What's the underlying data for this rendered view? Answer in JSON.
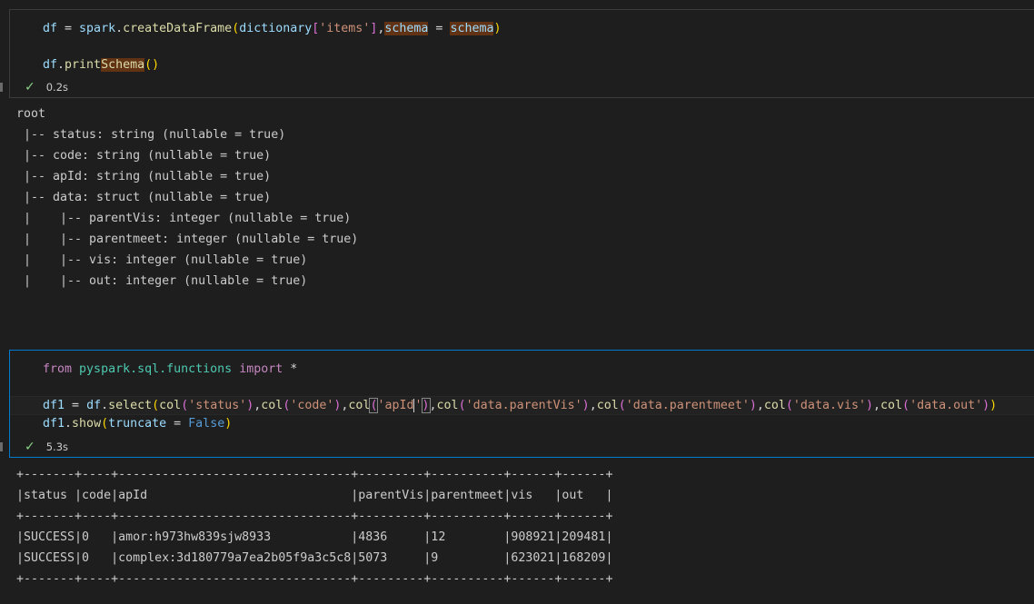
{
  "colors": {
    "background": "#1e1e1e",
    "focus_border": "#007acc",
    "success": "#89d185"
  },
  "cells": [
    {
      "code_lines": [
        [
          {
            "t": "df",
            "c": "#9cdcfe"
          },
          {
            "t": " = ",
            "c": "#d4d4d4"
          },
          {
            "t": "spark",
            "c": "#9cdcfe"
          },
          {
            "t": ".",
            "c": "#d4d4d4"
          },
          {
            "t": "createDataFrame",
            "c": "#dcdcaa"
          },
          {
            "t": "(",
            "c": "#ffd700"
          },
          {
            "t": "dictionary",
            "c": "#9cdcfe"
          },
          {
            "t": "[",
            "c": "#da70d6"
          },
          {
            "t": "'items'",
            "c": "#ce9178"
          },
          {
            "t": "]",
            "c": "#da70d6"
          },
          {
            "t": ",",
            "c": "#d4d4d4"
          },
          {
            "t": "schema",
            "c": "#9cdcfe",
            "hl": true
          },
          {
            "t": " = ",
            "c": "#d4d4d4"
          },
          {
            "t": "schema",
            "c": "#9cdcfe",
            "hl": true
          },
          {
            "t": ")",
            "c": "#ffd700"
          }
        ],
        [],
        [
          {
            "t": "df",
            "c": "#9cdcfe"
          },
          {
            "t": ".",
            "c": "#d4d4d4"
          },
          {
            "t": "print",
            "c": "#dcdcaa"
          },
          {
            "t": "Schema",
            "c": "#dcdcaa",
            "hl": true
          },
          {
            "t": "()",
            "c": "#ffd700"
          }
        ]
      ],
      "status_icon": "check-icon",
      "duration": "0.2s",
      "output": [
        "root",
        " |-- status: string (nullable = true)",
        " |-- code: string (nullable = true)",
        " |-- apId: string (nullable = true)",
        " |-- data: struct (nullable = true)",
        " |    |-- parentVis: integer (nullable = true)",
        " |    |-- parentmeet: integer (nullable = true)",
        " |    |-- vis: integer (nullable = true)",
        " |    |-- out: integer (nullable = true)"
      ]
    },
    {
      "code_lines": [
        [
          {
            "t": "from",
            "c": "#c586c0"
          },
          {
            "t": " ",
            "c": "#d4d4d4"
          },
          {
            "t": "pyspark.sql.functions",
            "c": "#4ec9b0"
          },
          {
            "t": " ",
            "c": "#d4d4d4"
          },
          {
            "t": "import",
            "c": "#c586c0"
          },
          {
            "t": " *",
            "c": "#d4d4d4"
          }
        ],
        [],
        [
          {
            "t": "df1",
            "c": "#9cdcfe"
          },
          {
            "t": " = ",
            "c": "#d4d4d4"
          },
          {
            "t": "df",
            "c": "#9cdcfe"
          },
          {
            "t": ".",
            "c": "#d4d4d4"
          },
          {
            "t": "select",
            "c": "#dcdcaa"
          },
          {
            "t": "(",
            "c": "#ffd700"
          },
          {
            "t": "col",
            "c": "#dcdcaa"
          },
          {
            "t": "(",
            "c": "#da70d6"
          },
          {
            "t": "'status'",
            "c": "#ce9178"
          },
          {
            "t": ")",
            "c": "#da70d6"
          },
          {
            "t": ",",
            "c": "#d4d4d4"
          },
          {
            "t": "col",
            "c": "#dcdcaa"
          },
          {
            "t": "(",
            "c": "#da70d6"
          },
          {
            "t": "'code'",
            "c": "#ce9178"
          },
          {
            "t": ")",
            "c": "#da70d6"
          },
          {
            "t": ",",
            "c": "#d4d4d4"
          },
          {
            "t": "col",
            "c": "#dcdcaa"
          },
          {
            "t": "(",
            "c": "#da70d6",
            "box": true
          },
          {
            "t": "'apId",
            "c": "#ce9178",
            "cursor": true
          },
          {
            "t": "'",
            "c": "#ce9178"
          },
          {
            "t": ")",
            "c": "#da70d6",
            "box": true
          },
          {
            "t": ",",
            "c": "#d4d4d4"
          },
          {
            "t": "col",
            "c": "#dcdcaa"
          },
          {
            "t": "(",
            "c": "#da70d6"
          },
          {
            "t": "'data.parentVis'",
            "c": "#ce9178"
          },
          {
            "t": ")",
            "c": "#da70d6"
          },
          {
            "t": ",",
            "c": "#d4d4d4"
          },
          {
            "t": "col",
            "c": "#dcdcaa"
          },
          {
            "t": "(",
            "c": "#da70d6"
          },
          {
            "t": "'data.parentmeet'",
            "c": "#ce9178"
          },
          {
            "t": ")",
            "c": "#da70d6"
          },
          {
            "t": ",",
            "c": "#d4d4d4"
          },
          {
            "t": "col",
            "c": "#dcdcaa"
          },
          {
            "t": "(",
            "c": "#da70d6"
          },
          {
            "t": "'data.vis'",
            "c": "#ce9178"
          },
          {
            "t": ")",
            "c": "#da70d6"
          },
          {
            "t": ",",
            "c": "#d4d4d4"
          },
          {
            "t": "col",
            "c": "#dcdcaa"
          },
          {
            "t": "(",
            "c": "#da70d6"
          },
          {
            "t": "'data.out'",
            "c": "#ce9178"
          },
          {
            "t": ")",
            "c": "#da70d6"
          },
          {
            "t": ")",
            "c": "#ffd700"
          }
        ],
        [
          {
            "t": "df1",
            "c": "#9cdcfe"
          },
          {
            "t": ".",
            "c": "#d4d4d4"
          },
          {
            "t": "show",
            "c": "#dcdcaa"
          },
          {
            "t": "(",
            "c": "#ffd700"
          },
          {
            "t": "truncate",
            "c": "#9cdcfe"
          },
          {
            "t": " = ",
            "c": "#d4d4d4"
          },
          {
            "t": "False",
            "c": "#569cd6"
          },
          {
            "t": ")",
            "c": "#ffd700"
          }
        ]
      ],
      "status_icon": "check-icon",
      "duration": "5.3s",
      "output": [
        "+-------+----+--------------------------------+---------+----------+------+------+",
        "|status |code|apId                            |parentVis|parentmeet|vis   |out   |",
        "+-------+----+--------------------------------+---------+----------+------+------+",
        "|SUCCESS|0   |amor:h973hw839sjw8933           |4836     |12        |908921|209481|",
        "|SUCCESS|0   |complex:3d180779a7ea2b05f9a3c5c8|5073     |9         |623021|168209|",
        "+-------+----+--------------------------------+---------+----------+------+------+"
      ]
    }
  ]
}
